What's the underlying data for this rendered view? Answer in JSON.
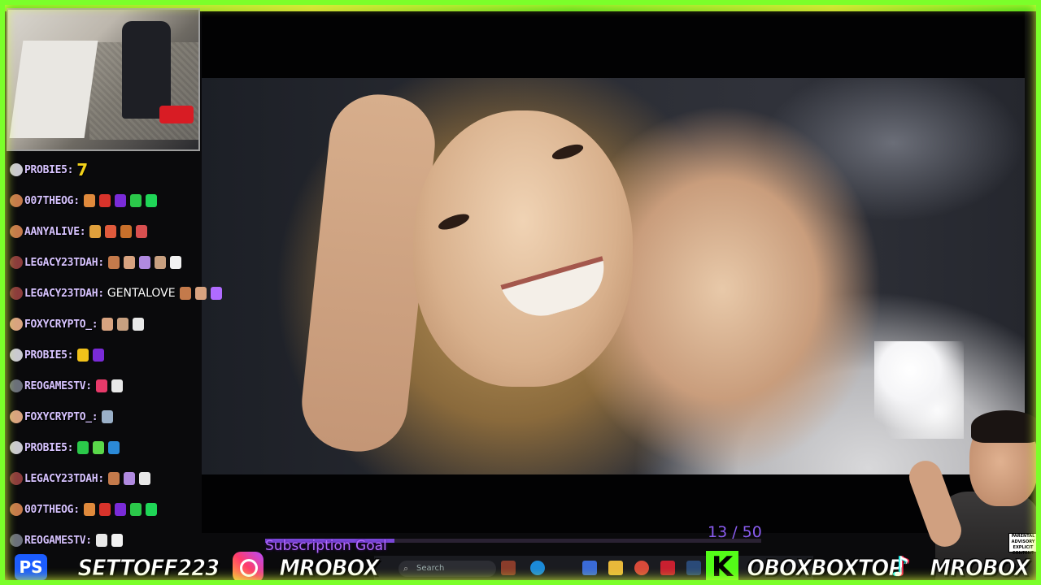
{
  "chat": {
    "messages": [
      {
        "user": "PROBIE5:",
        "text": "7",
        "avatar_color": "#c9c9d0",
        "emotes": []
      },
      {
        "user": "007THEOG:",
        "text": "",
        "avatar_color": "#c47a4b",
        "emotes": [
          "#e08a3c",
          "#d8332b",
          "#7a2bd8",
          "#2bc84a",
          "#1fd657"
        ]
      },
      {
        "user": "AANYALIVE:",
        "text": "",
        "avatar_color": "#c47a4b",
        "emotes": [
          "#e0a03c",
          "#e05a3c",
          "#c8702b",
          "#d84f4f"
        ]
      },
      {
        "user": "LEGACY23TDAH:",
        "text": "",
        "avatar_color": "#8b3c3c",
        "emotes": [
          "#c47a4b",
          "#d8a380",
          "#b08ae0",
          "#c8a080",
          "#f2f2f2"
        ]
      },
      {
        "user": "LEGACY23TDAH:",
        "text": "GENTALOVE",
        "avatar_color": "#8b3c3c",
        "emotes": [
          "#c47a4b",
          "#d8a380",
          "#b06bff"
        ]
      },
      {
        "user": "FOXYCRYPTO_:",
        "text": "",
        "avatar_color": "#d8a380",
        "emotes": [
          "#d8a380",
          "#c8a080",
          "#e8e8e8"
        ]
      },
      {
        "user": "PROBIE5:",
        "text": "",
        "avatar_color": "#c9c9d0",
        "emotes": [
          "#f2c21a",
          "#7a2bd8"
        ]
      },
      {
        "user": "REOGAMESTV:",
        "text": "",
        "avatar_color": "#6a6f7a",
        "emotes": [
          "#e83a6a",
          "#e8e8e8"
        ]
      },
      {
        "user": "FOXYCRYPTO_:",
        "text": "",
        "avatar_color": "#d8a380",
        "emotes": [
          "#9ab0c8"
        ]
      },
      {
        "user": "PROBIE5:",
        "text": "",
        "avatar_color": "#c9c9d0",
        "emotes": [
          "#2bc84a",
          "#5ad84a",
          "#2b8ad8"
        ]
      },
      {
        "user": "LEGACY23TDAH:",
        "text": "",
        "avatar_color": "#8b3c3c",
        "emotes": [
          "#c47a4b",
          "#b08ae0",
          "#e8e8e8"
        ]
      },
      {
        "user": "007THEOG:",
        "text": "",
        "avatar_color": "#c47a4b",
        "emotes": [
          "#e08a3c",
          "#d8332b",
          "#7a2bd8",
          "#2bc84a",
          "#1fd657"
        ]
      },
      {
        "user": "REOGAMESTV:",
        "text": "",
        "avatar_color": "#6a6f7a",
        "emotes": [
          "#e8e8e8",
          "#f2f2f2"
        ]
      }
    ]
  },
  "subscription_goal": {
    "label": "Subscription Goal",
    "current": 13,
    "target": 50,
    "count_text": "13 / 50",
    "color": "#8a5cf0"
  },
  "taskbar": {
    "search_placeholder": "Search"
  },
  "socials": [
    {
      "platform": "playstation",
      "icon": "playstation-icon",
      "handle": "SETTOFF223",
      "icon_glyph": "PS"
    },
    {
      "platform": "instagram",
      "icon": "instagram-icon",
      "handle": "MROBOX"
    },
    {
      "platform": "kick",
      "icon": "kick-icon",
      "handle": "OBOXBOXTOP",
      "icon_glyph": "K"
    },
    {
      "platform": "tiktok",
      "icon": "tiktok-icon",
      "handle": "MROBOX",
      "icon_glyph": "♪"
    }
  ],
  "advisory": "PARENTAL ADVISORY EXPLICIT CONTENT",
  "colors": {
    "frame": "#7bff2a",
    "chat_username": "#d7c3ff",
    "goal": "#8a5cf0"
  }
}
